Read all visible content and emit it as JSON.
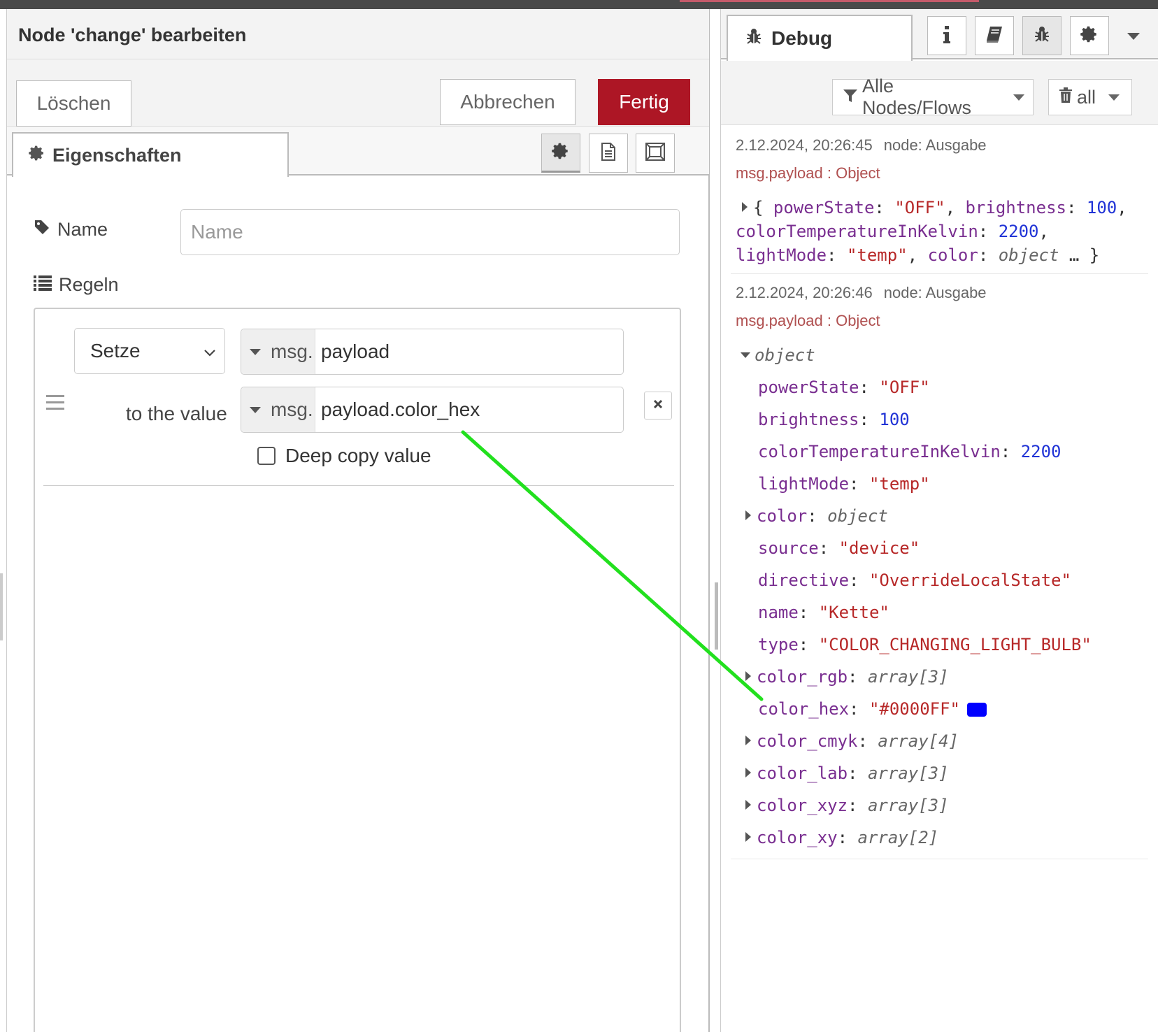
{
  "editor": {
    "title": "Node 'change' bearbeiten",
    "delete_label": "Löschen",
    "cancel_label": "Abbrechen",
    "done_label": "Fertig",
    "tab_properties": "Eigenschaften",
    "tab_icons": [
      "gear-icon",
      "description-icon",
      "appearance-icon"
    ],
    "name_label": "Name",
    "name_placeholder": "Name",
    "rules_label": "Regeln",
    "rule": {
      "action": "Setze",
      "target_prefix": "msg.",
      "target_value": "payload",
      "to_label": "to the value",
      "source_prefix": "msg.",
      "source_value": "payload.color_hex",
      "deep_copy_label": "Deep copy value",
      "deep_copy_checked": false
    }
  },
  "sidebar": {
    "tab_label": "Debug",
    "tab_icons": [
      "info-icon",
      "book-icon",
      "bug-icon",
      "gear-icon"
    ],
    "filter_label": "Alle Nodes/Flows",
    "clear_label": "all",
    "messages": [
      {
        "timestamp": "2.12.2024, 20:26:45",
        "node": "node: Ausgabe",
        "topic": "msg.payload : Object",
        "collapsed": [
          "{ ",
          "powerState",
          ": ",
          "\"OFF\"",
          ", ",
          "brightness",
          ": ",
          "100",
          ",",
          "colorTemperatureInKelvin",
          ": ",
          "2200",
          ",",
          "lightMode",
          ": ",
          "\"temp\"",
          ", ",
          "color",
          ": ",
          "object",
          " … }"
        ]
      },
      {
        "timestamp": "2.12.2024, 20:26:46",
        "node": "node: Ausgabe",
        "topic": "msg.payload : Object",
        "root": "object",
        "props": [
          {
            "key": "powerState",
            "value": "\"OFF\""
          },
          {
            "key": "brightness",
            "value": "100"
          },
          {
            "key": "colorTemperatureInKelvin",
            "value": "2200"
          },
          {
            "key": "lightMode",
            "value": "\"temp\""
          },
          {
            "key": "color",
            "value": "object"
          },
          {
            "key": "source",
            "value": "\"device\""
          },
          {
            "key": "directive",
            "value": "\"OverrideLocalState\""
          },
          {
            "key": "name",
            "value": "\"Kette\""
          },
          {
            "key": "type",
            "value": "\"COLOR_CHANGING_LIGHT_BULB\""
          },
          {
            "key": "color_rgb",
            "value": "array[3]"
          },
          {
            "key": "color_hex",
            "value": "\"#0000FF\""
          },
          {
            "key": "color_cmyk",
            "value": "array[4]"
          },
          {
            "key": "color_lab",
            "value": "array[3]"
          },
          {
            "key": "color_xyz",
            "value": "array[3]"
          },
          {
            "key": "color_xy",
            "value": "array[2]"
          }
        ]
      }
    ]
  },
  "colors": {
    "accent_red": "#ad1625",
    "annotation_green": "#22e01e",
    "color_swatch": "#0000FF",
    "key_purple": "#792e90",
    "string_red": "#b72828",
    "number_blue": "#2033d6"
  }
}
